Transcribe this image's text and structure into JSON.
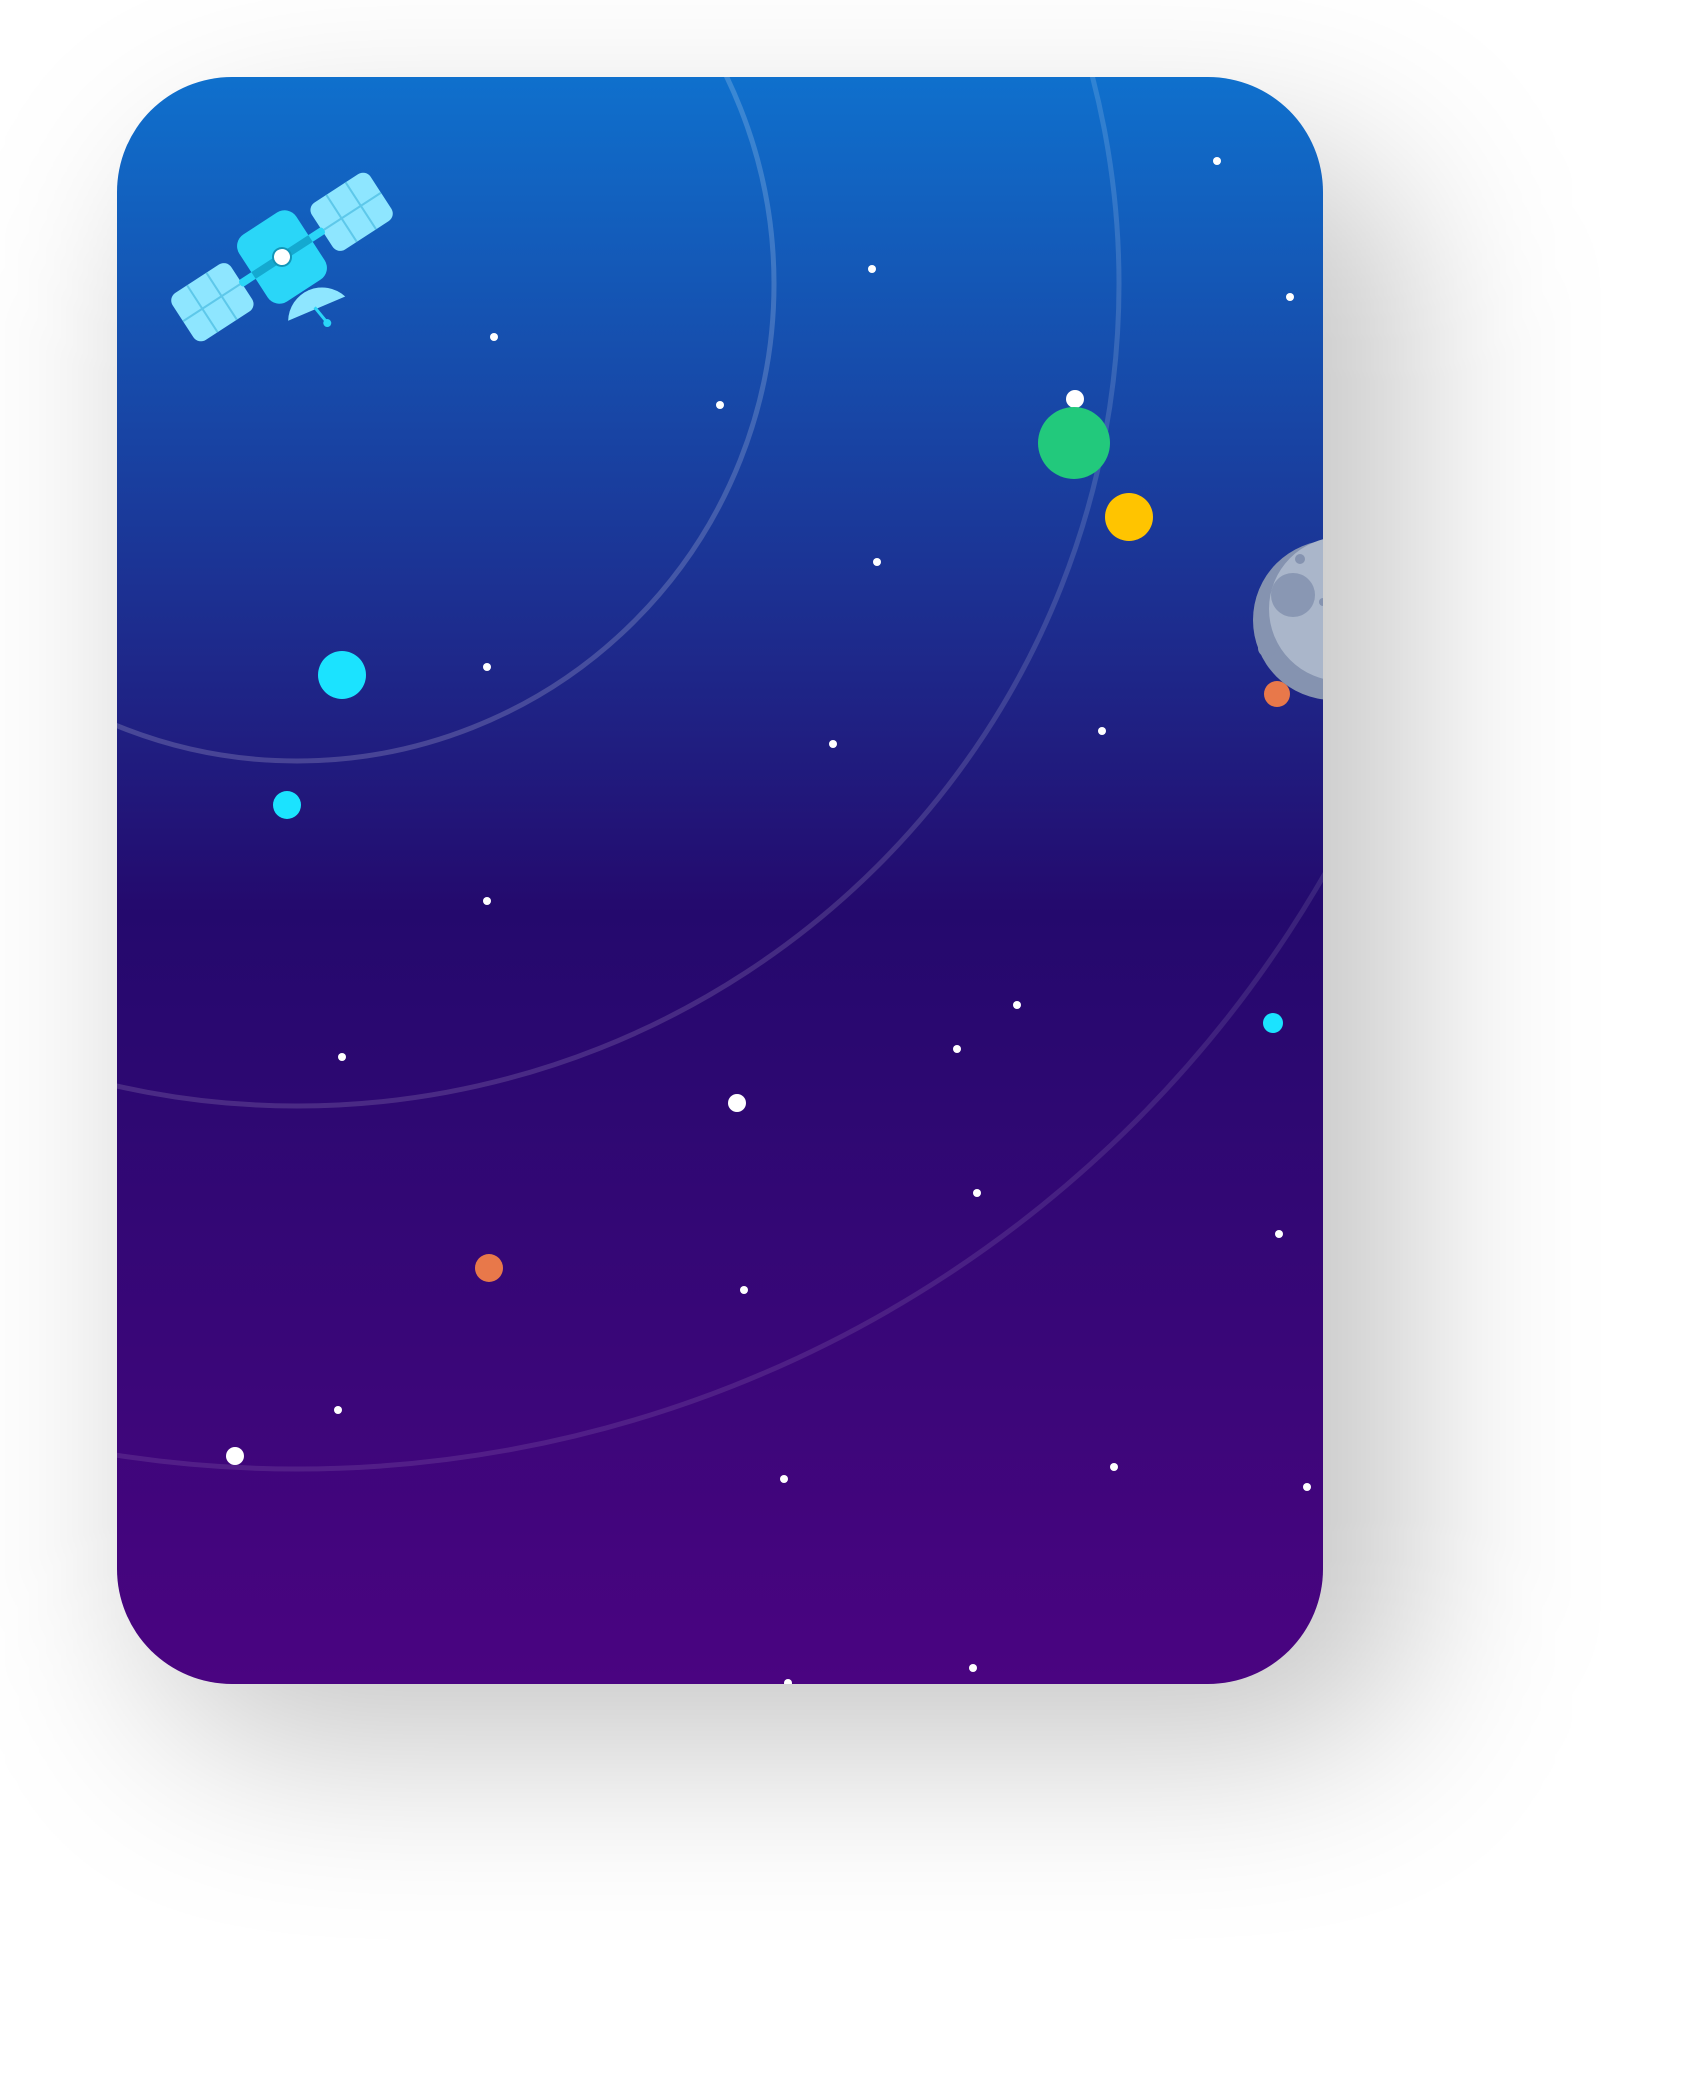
{
  "scene": {
    "colors": {
      "gradient_top": "#0f70cd",
      "gradient_mid": "#24096d",
      "gradient_bottom": "#4a0481",
      "orbit_line": "#ffffff",
      "star": "#ffffff",
      "planet_green": "#22c97c",
      "planet_yellow": "#ffc400",
      "planet_cyan": "#1be3ff",
      "planet_orange": "#e8784a",
      "moon_light": "#aab6ca",
      "moon_dark": "#8593b0",
      "satellite_panel": "#8ee6ff",
      "satellite_body": "#2ad6f8"
    },
    "icons": {
      "satellite": "satellite-icon",
      "moon": "moon-icon"
    }
  }
}
